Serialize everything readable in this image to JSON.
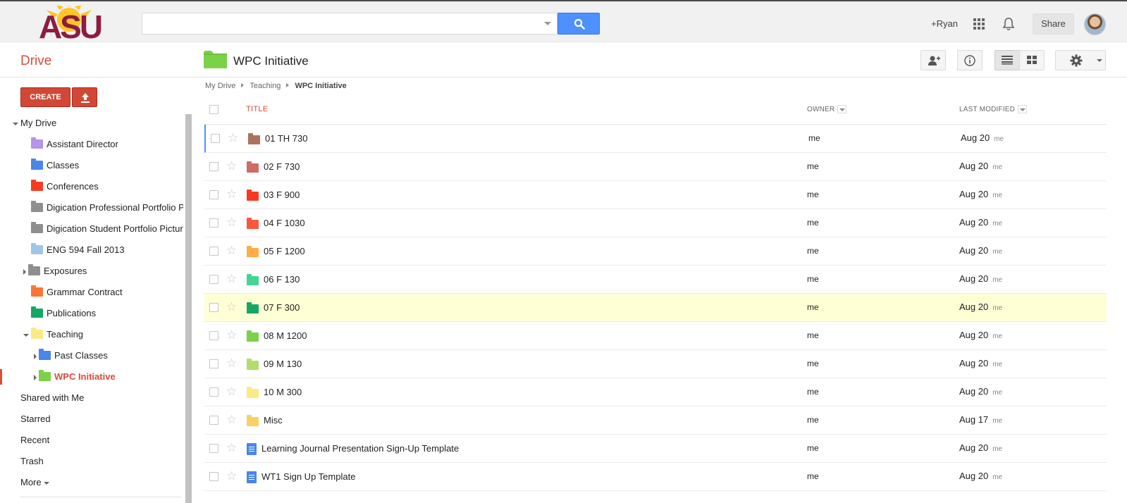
{
  "header": {
    "logo_text": "ASU",
    "search_placeholder": "",
    "user_label": "+Ryan",
    "share_label": "Share"
  },
  "toolbar": {
    "app_title": "Drive",
    "current_folder": "WPC Initiative"
  },
  "sidebar": {
    "create_label": "CREATE",
    "items": [
      {
        "label": "My Drive",
        "color": "",
        "level": 0,
        "toggle": "down"
      },
      {
        "label": "Assistant Director",
        "color": "#b694e8",
        "level": 1,
        "toggle": ""
      },
      {
        "label": "Classes",
        "color": "#4a86e8",
        "level": 1,
        "toggle": ""
      },
      {
        "label": "Conferences",
        "color": "#f83a22",
        "level": 1,
        "toggle": ""
      },
      {
        "label": "Digication Professional Portfolio Pictures",
        "color": "#8f8f8f",
        "level": 1,
        "toggle": "",
        "shared": true
      },
      {
        "label": "Digication Student Portfolio Pictures",
        "color": "#8f8f8f",
        "level": 1,
        "toggle": "",
        "shared": true
      },
      {
        "label": "ENG 594 Fall 2013",
        "color": "#9fc6e7",
        "level": 1,
        "toggle": "",
        "shared": true
      },
      {
        "label": "Exposures",
        "color": "#8f8f8f",
        "level": 1,
        "toggle": "right"
      },
      {
        "label": "Grammar Contract",
        "color": "#ff7537",
        "level": 1,
        "toggle": ""
      },
      {
        "label": "Publications",
        "color": "#16a765",
        "level": 1,
        "toggle": ""
      },
      {
        "label": "Teaching",
        "color": "#fbe983",
        "level": 1,
        "toggle": "down"
      },
      {
        "label": "Past Classes",
        "color": "#4a86e8",
        "level": 2,
        "toggle": "right"
      },
      {
        "label": "WPC Initiative",
        "color": "#7bd148",
        "level": 2,
        "toggle": "right",
        "active": true
      }
    ],
    "links": [
      "Shared with Me",
      "Starred",
      "Recent",
      "Trash"
    ],
    "more_label": "More"
  },
  "breadcrumb": [
    "My Drive",
    "Teaching",
    "WPC Initiative"
  ],
  "columns": {
    "title": "TITLE",
    "owner": "OWNER",
    "modified": "LAST MODIFIED"
  },
  "files": [
    {
      "name": "01 TH 730",
      "type": "folder",
      "color": "#ac725e",
      "owner": "me",
      "date": "Aug 20",
      "by": "me"
    },
    {
      "name": "02 F 730",
      "type": "folder",
      "color": "#d06b64",
      "owner": "me",
      "date": "Aug 20",
      "by": "me"
    },
    {
      "name": "03 F 900",
      "type": "folder",
      "color": "#f83a22",
      "owner": "me",
      "date": "Aug 20",
      "by": "me"
    },
    {
      "name": "04 F 1030",
      "type": "folder",
      "color": "#fa573c",
      "owner": "me",
      "date": "Aug 20",
      "by": "me"
    },
    {
      "name": "05 F 1200",
      "type": "folder",
      "color": "#ffad46",
      "owner": "me",
      "date": "Aug 20",
      "by": "me"
    },
    {
      "name": "06 F 130",
      "type": "folder",
      "color": "#42d692",
      "owner": "me",
      "date": "Aug 20",
      "by": "me"
    },
    {
      "name": "07 F 300",
      "type": "folder",
      "color": "#16a765",
      "owner": "me",
      "date": "Aug 20",
      "by": "me"
    },
    {
      "name": "08 M 1200",
      "type": "folder",
      "color": "#7bd148",
      "owner": "me",
      "date": "Aug 20",
      "by": "me"
    },
    {
      "name": "09 M 130",
      "type": "folder",
      "color": "#b3dc6c",
      "owner": "me",
      "date": "Aug 20",
      "by": "me"
    },
    {
      "name": "10 M 300",
      "type": "folder",
      "color": "#fbe983",
      "owner": "me",
      "date": "Aug 20",
      "by": "me"
    },
    {
      "name": "Misc",
      "type": "folder",
      "color": "#fad165",
      "owner": "me",
      "date": "Aug 17",
      "by": "me"
    },
    {
      "name": "Learning Journal Presentation Sign-Up Template",
      "type": "doc",
      "color": "#4a86e8",
      "owner": "me",
      "date": "Aug 20",
      "by": "me"
    },
    {
      "name": "WT1 Sign Up Template",
      "type": "doc",
      "color": "#4a86e8",
      "owner": "me",
      "date": "Aug 20",
      "by": "me"
    }
  ],
  "highlighted_row": "07 F 300",
  "selected_row": "01 TH 730",
  "colors": {
    "accent": "#dd4b39",
    "search_button": "#4d90fe",
    "create_button": "#d14836",
    "highlight": "#ffffd6"
  }
}
